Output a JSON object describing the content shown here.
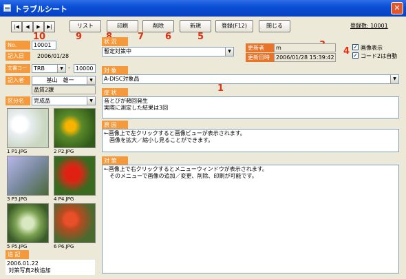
{
  "window": {
    "title": "トラブルシート",
    "close": "✕"
  },
  "toolbar": {
    "nav_first": "|◀",
    "nav_prev": "◀",
    "nav_next": "▶",
    "nav_last": "▶|",
    "list": "リスト",
    "print": "印刷",
    "delete": "削除",
    "new": "新規",
    "register": "登録(F12)",
    "close": "閉じる",
    "registered_count": "登録数: 10001"
  },
  "callouts": {
    "c1": "1",
    "c2": "2",
    "c3": "3",
    "c4": "4",
    "c5": "5",
    "c6": "6",
    "c7": "7",
    "c8": "8",
    "c9": "9",
    "c10": "10"
  },
  "record": {
    "no_label": "No.",
    "no": "10001",
    "date_label": "記入日",
    "date": "2006/01/28",
    "doc_label": "文書コード",
    "doc_code": "TRB",
    "doc_sep": "-",
    "doc_num": "10000",
    "author_label": "記入者",
    "author": "基山　雄一",
    "dept": "品質2課",
    "category_label": "区分名",
    "category": "完成品",
    "status_label": "状 況",
    "status": "暫定対策中",
    "updater_label": "更新者",
    "updater": "m",
    "updated_label": "更新日時",
    "updated_at": "2006/01/28 15:39:42"
  },
  "options": {
    "show_image": "画像表示",
    "auto_code": "コード2は自動",
    "check": "✓"
  },
  "sections": {
    "target_label": "対 象",
    "target": "A-DISC対象品",
    "symptom_label": "症 状",
    "symptom": "音とびが頻回発生\n実際に測定した結果は3回",
    "cause_label": "原 因",
    "cause": "←画像上で左クリックすると画像ビューが表示されます。\n　画像を拡大／縮小し見ることができます。",
    "measure_label": "対 策",
    "measure": "←画像上で右クリックするとメニューウィンドウが表示されます。\n　そのメニューで画像の追加／変更、削除、印刷が可能です。"
  },
  "thumbnails": [
    {
      "caption": "1 P1.JPG"
    },
    {
      "caption": "2 P2.JPG"
    },
    {
      "caption": "3 P3.JPG"
    },
    {
      "caption": "4 P4.JPG"
    },
    {
      "caption": "5 P5.JPG"
    },
    {
      "caption": "6 P6.JPG"
    }
  ],
  "notes": {
    "label": "追 記",
    "text": "2006.01.22\n 対策写真2枚追加"
  },
  "dropdown_arrow": "▼",
  "scroll_up": "▲"
}
